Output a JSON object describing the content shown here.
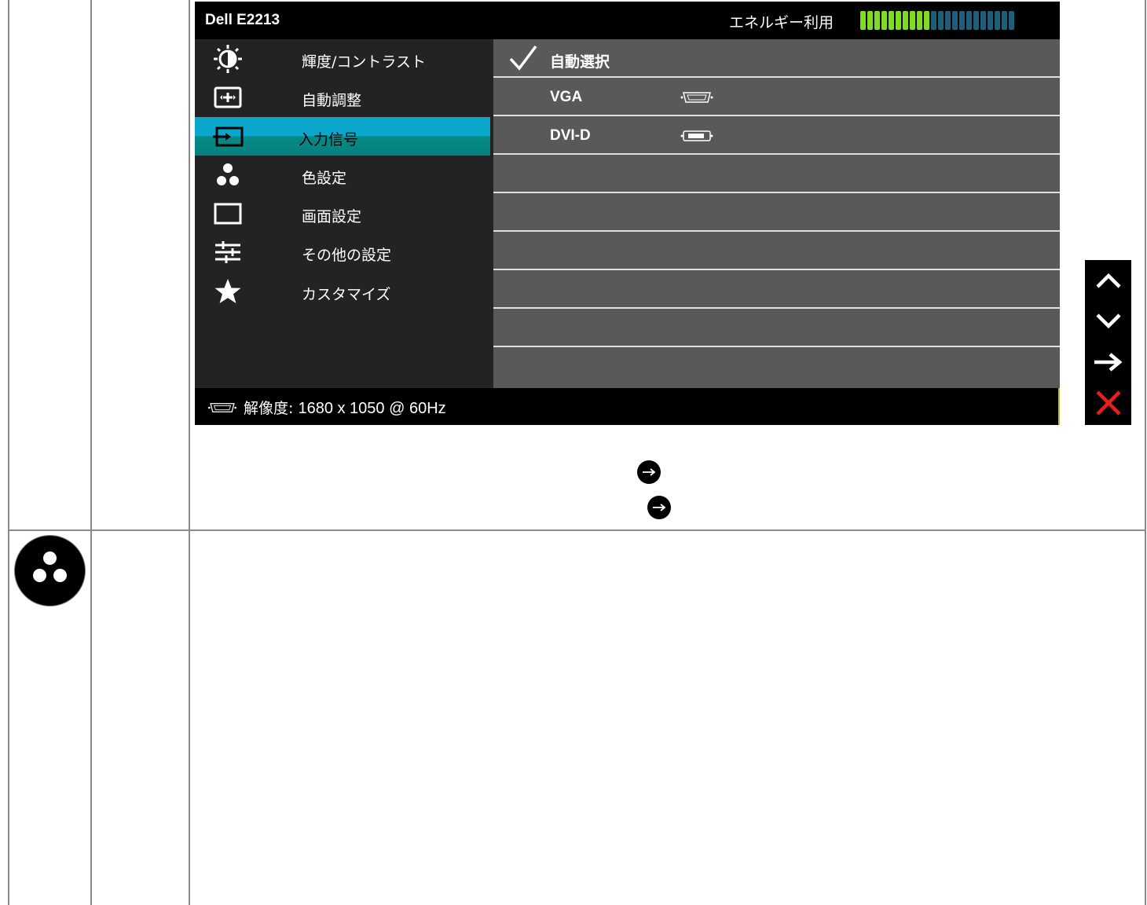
{
  "osd": {
    "model": "Dell E2213",
    "energy_label": "エネルギー利用",
    "energy_level": 0.45,
    "energy_colors": {
      "on": "#7fdd1f",
      "off": "#1d5e7a"
    },
    "menu": [
      {
        "label": "輝度/コントラスト",
        "icon": "brightness-icon"
      },
      {
        "label": "自動調整",
        "icon": "auto-adjust-icon"
      },
      {
        "label": "入力信号",
        "icon": "input-source-icon",
        "active": true
      },
      {
        "label": "色設定",
        "icon": "color-settings-icon"
      },
      {
        "label": "画面設定",
        "icon": "display-settings-icon"
      },
      {
        "label": "その他の設定",
        "icon": "other-settings-icon"
      },
      {
        "label": "カスタマイズ",
        "icon": "star-icon"
      }
    ],
    "submenu": [
      {
        "label": "自動選択",
        "checked": true
      },
      {
        "label": "VGA",
        "icon": "vga-connector-icon"
      },
      {
        "label": "DVI-D",
        "icon": "dvi-connector-icon"
      }
    ],
    "footer": {
      "resolution_label": "解像度:",
      "resolution_value": "1680 x 1050 @ 60Hz"
    },
    "accent_color": "#0aa6cc"
  },
  "side_buttons": [
    "up-arrow-icon",
    "down-arrow-icon",
    "right-arrow-icon",
    "close-icon"
  ]
}
